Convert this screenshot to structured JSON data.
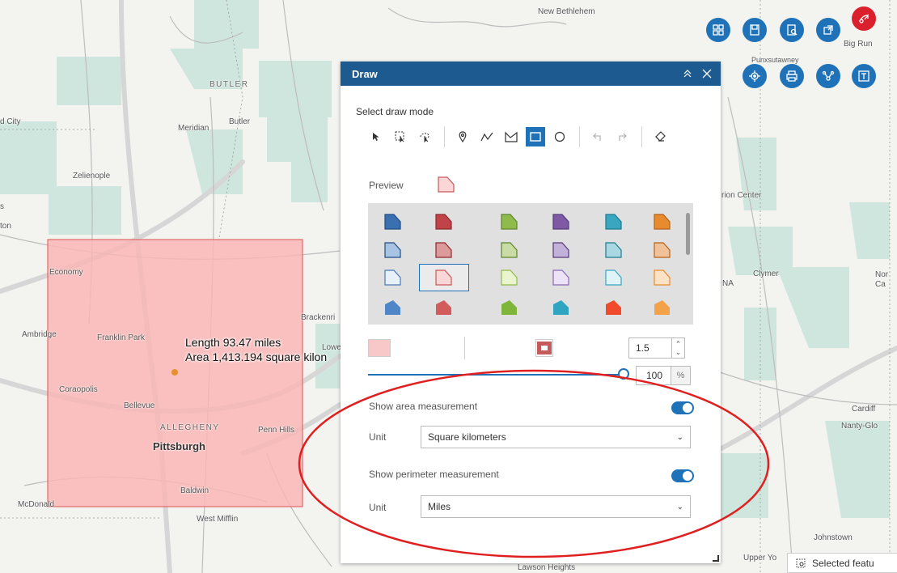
{
  "map": {
    "labels": {
      "new_bethlehem": "New Bethlehem",
      "punxsutawney": "Punxsutawney",
      "big_run": "Big Run",
      "butler_county": "BUTLER",
      "butler": "Butler",
      "meridian": "Meridian",
      "d_city": "d City",
      "zelienople": "Zelienople",
      "s": "s",
      "ton": "ton",
      "economy": "Economy",
      "brackenridge": "Brackenri",
      "ambridge": "Ambridge",
      "franklin_park": "Franklin Park",
      "lower": "Lowe",
      "coraopolis": "Coraopolis",
      "bellevue": "Bellevue",
      "allegheny": "ALLEGHENY",
      "penn_hills": "Penn Hills",
      "pittsburgh": "Pittsburgh",
      "baldwin": "Baldwin",
      "mcdonald": "McDonald",
      "west_mifflin": "West Mifflin",
      "rion_center": "rion Center",
      "clymer": "Clymer",
      "na": "NA",
      "nor": "Nor",
      "ca": "Ca",
      "cardiff": "Cardiff",
      "nanty_glo": "Nanty-Glo",
      "johnstown": "Johnstown",
      "upper_yo": "Upper Yo",
      "lawson_heights": "Lawson Heights"
    },
    "measurement": {
      "length": "Length 93.47 miles",
      "area": "Area 1,413.194 square kilon"
    },
    "rect_fill_color": "#f9b6b6",
    "rect_stroke_color": "#e06a6a",
    "water_color": "#c9e6e2"
  },
  "toolbar": {
    "buttons": [
      {
        "name": "basemap-gallery-button",
        "icon": "grid-icon"
      },
      {
        "name": "bookmark-button",
        "icon": "bookmark-icon"
      },
      {
        "name": "query-button",
        "icon": "query-icon"
      },
      {
        "name": "share-button",
        "icon": "share-icon"
      },
      {
        "name": "draw-button",
        "icon": "draw-icon"
      },
      {
        "name": "search-layer-button",
        "icon": "locate-icon"
      },
      {
        "name": "print-button",
        "icon": "print-icon"
      },
      {
        "name": "analysis-button",
        "icon": "network-icon"
      },
      {
        "name": "text-button",
        "icon": "text-icon"
      }
    ],
    "accent": "#1f72b8",
    "active_color": "#d9202c"
  },
  "draw": {
    "title": "Draw",
    "mode_label": "Select draw mode",
    "preview_label": "Preview",
    "outline_width": "1.5",
    "transparency": "100",
    "transparency_unit": "%",
    "show_area_label": "Show area measurement",
    "area_unit_label": "Unit",
    "area_unit": "Square kilometers",
    "show_perimeter_label": "Show perimeter measurement",
    "perimeter_unit_label": "Unit",
    "perimeter_unit": "Miles",
    "show_area": true,
    "show_perimeter": true,
    "palette": [
      [
        "#3a6fb0",
        "#c0434a",
        "#8fbb4a",
        "#7e5aa5",
        "#3aa6c0",
        "#e88a2e"
      ],
      [
        "#a9c3e2",
        "#dd9a9a",
        "#c9dca6",
        "#c2b1d8",
        "#a9d8e2",
        "#f1c29a"
      ],
      [
        "#e8f0fa",
        "#fbd6d6",
        "#eaf5cf",
        "#ede3f6",
        "#dff4f9",
        "#fde2c6"
      ],
      [
        "#4e86c8",
        "#d25b5b",
        "#7fb53a",
        "#2fa5c2",
        "#f04b2c",
        "#f3a24a"
      ]
    ],
    "palette_border": [
      [
        "#1f4e85",
        "#8e2a2e",
        "#5d862c",
        "#563a7c",
        "#1f7a90",
        "#b3611a"
      ],
      [
        "#1f4e85",
        "#8e2a2e",
        "#5d862c",
        "#563a7c",
        "#1f7a90",
        "#b3611a"
      ],
      [
        "#4a78b4",
        "#c65a5a",
        "#8fbb4a",
        "#8a6ab4",
        "#3aa6c0",
        "#e88a2e"
      ],
      [
        "#4e86c8",
        "#d25b5b",
        "#7fb53a",
        "#2fa5c2",
        "#f04b2c",
        "#f3a24a"
      ]
    ],
    "selected_fill": "#fbd6d6",
    "selected_outline": "#c65a5a"
  },
  "status": {
    "selected_features": "Selected featu"
  }
}
